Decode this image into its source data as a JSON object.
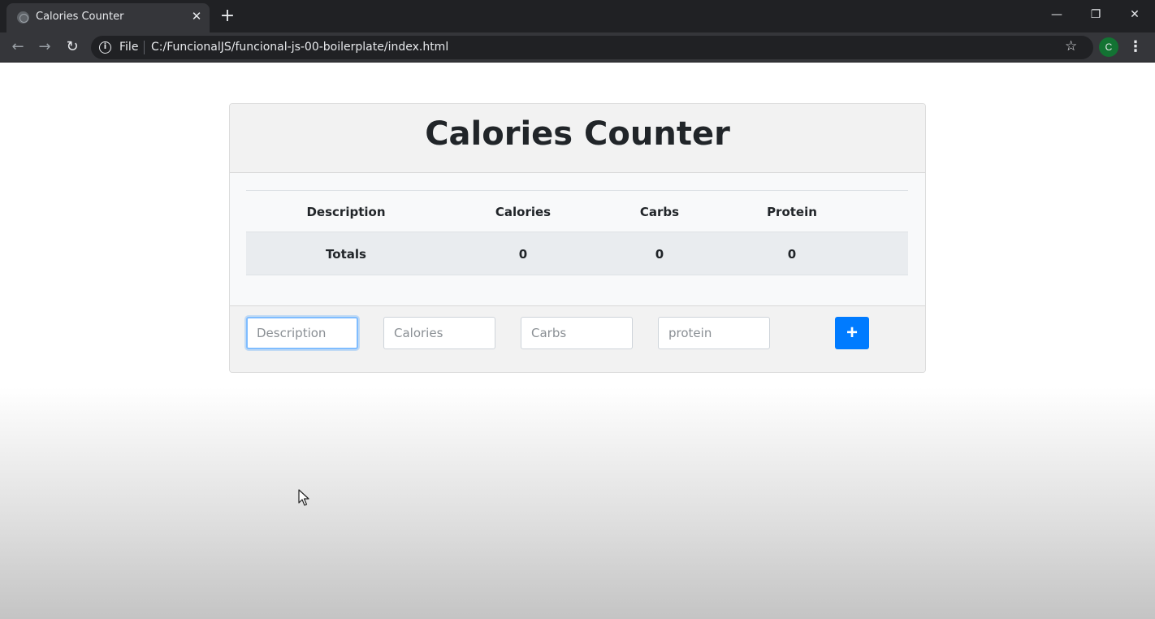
{
  "browser": {
    "tab_title": "Calories Counter",
    "tab_close": "✕",
    "new_tab": "+",
    "window_controls": {
      "minimize": "—",
      "restore": "❐",
      "close": "✕"
    },
    "nav": {
      "back": "←",
      "forward": "→",
      "reload": "↻"
    },
    "address": {
      "info_icon": "i",
      "scheme_label": "File",
      "url": "C:/FuncionalJS/funcional-js-00-boilerplate/index.html"
    },
    "bookmark_star": "☆",
    "profile_initial": "C",
    "menu_icon": "⋮"
  },
  "app": {
    "title": "Calories Counter",
    "table": {
      "headers": [
        "Description",
        "Calories",
        "Carbs",
        "Protein"
      ],
      "totals": {
        "label": "Totals",
        "calories": "0",
        "carbs": "0",
        "protein": "0"
      }
    },
    "form": {
      "description_placeholder": "Description",
      "calories_placeholder": "Calories",
      "carbs_placeholder": "Carbs",
      "protein_placeholder": "protein",
      "add_button_label": "+"
    }
  },
  "colors": {
    "accent": "#007bff",
    "chrome_dark": "#202124",
    "chrome_toolbar": "#35363a",
    "focus_ring": "#80bdff"
  }
}
